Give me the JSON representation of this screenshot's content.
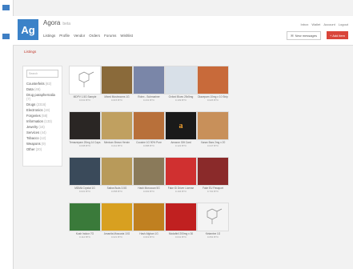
{
  "brand": {
    "logo": "Ag",
    "name": "Agora",
    "sub": "beta"
  },
  "nav": [
    "Listings",
    "Profile",
    "Vendor",
    "Orders",
    "Forums",
    "Wishlist"
  ],
  "top_links": [
    "Inbox",
    "Wallet",
    "Account",
    "Logout"
  ],
  "buttons": {
    "messages": "New messages",
    "add": "+ Add item"
  },
  "breadcrumb": "Listings",
  "sidebar": {
    "search_placeholder": "Search",
    "categories": [
      {
        "name": "Counterfeits",
        "count": "(82)"
      },
      {
        "name": "Data",
        "count": "(46)"
      },
      {
        "name": "Drug paraphernalia",
        "count": "(7)"
      },
      {
        "name": "Drugs",
        "count": "(2316)"
      },
      {
        "name": "Electronics",
        "count": "(19)"
      },
      {
        "name": "Forgeries",
        "count": "(58)"
      },
      {
        "name": "Information",
        "count": "(133)"
      },
      {
        "name": "Jewelry",
        "count": "(16)"
      },
      {
        "name": "Services",
        "count": "(44)"
      },
      {
        "name": "Tobacco",
        "count": "(12)"
      },
      {
        "name": "Weapons",
        "count": "(9)"
      },
      {
        "name": "Other",
        "count": "(20)"
      }
    ]
  },
  "listings": [
    {
      "caption": "MDPV 1.5G Sample",
      "price": "0.041 BTC",
      "color": "#ffffff",
      "kind": "molecule"
    },
    {
      "caption": "Mixed Mushrooms 1G",
      "price": "0.015 BTC",
      "color": "#8a6a3a"
    },
    {
      "caption": "Rolex - Submariner",
      "price": "0.231 BTC",
      "color": "#7a86a8"
    },
    {
      "caption": "Oxford Blues 25x5mg",
      "price": "0.109 BTC",
      "color": "#d8e0e8"
    },
    {
      "caption": "Diazepam 10mg x 10 Strip",
      "price": "0.026 BTC",
      "color": "#c86a3a"
    },
    {
      "caption": "Temazepam 20mg 14 Caps",
      "price": "0.038 BTC",
      "color": "#2a2624"
    },
    {
      "caption": "Mexican Brown Heroin",
      "price": "0.211 BTC",
      "color": "#c0a060"
    },
    {
      "caption": "Cocaine 1G 90% Pure",
      "price": "0.088 BTC",
      "color": "#b8703a"
    },
    {
      "caption": "Amazon Gift Card",
      "price": "0.122 BTC",
      "color": "#1a1a1a",
      "kind": "amazon"
    },
    {
      "caption": "Xanax Bars 2mg x 20",
      "price": "0.047 BTC",
      "color": "#c8905a"
    },
    {
      "caption": "MDMA Crystal 1G",
      "price": "0.031 BTC",
      "color": "#3a4a5a"
    },
    {
      "caption": "Sativa Buds 3.5G",
      "price": "0.058 BTC",
      "color": "#b89a5a"
    },
    {
      "caption": "Hash Moroccan 5G",
      "price": "0.093 BTC",
      "color": "#8a7a5a"
    },
    {
      "caption": "Fake ID Driver License",
      "price": "0.194 BTC",
      "color": "#d03030"
    },
    {
      "caption": "Fake EU Passport",
      "price": "0.702 BTC",
      "color": "#8a2a2a"
    },
    {
      "caption": "Kush Indoor 7G",
      "price": "0.112 BTC",
      "color": "#3a7a3a"
    },
    {
      "caption": "Amanita Muscaria 10G",
      "price": "0.021 BTC",
      "color": "#d8a020"
    },
    {
      "caption": "Hash Afghan 1G",
      "price": "0.019 BTC",
      "color": "#c08020"
    },
    {
      "caption": "Modafinil 200mg x 30",
      "price": "0.041 BTC",
      "color": "#c02020"
    },
    {
      "caption": "Ketamine 1G",
      "price": "0.054 BTC",
      "color": "#f4f4f4",
      "kind": "molecule"
    }
  ]
}
